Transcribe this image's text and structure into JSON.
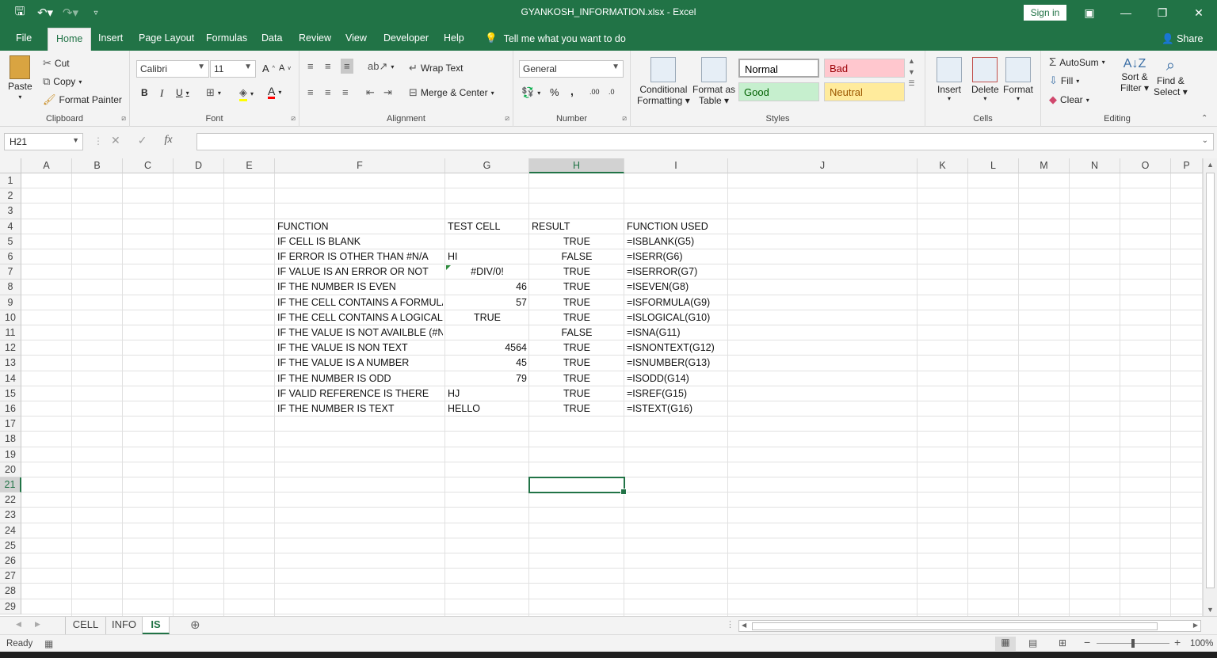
{
  "window": {
    "title": "GYANKOSH_INFORMATION.xlsx  -  Excel",
    "sign_in": "Sign in",
    "share": "Share"
  },
  "tabs": [
    "File",
    "Home",
    "Insert",
    "Page Layout",
    "Formulas",
    "Data",
    "Review",
    "View",
    "Developer",
    "Help"
  ],
  "active_tab": "Home",
  "tell_me": "Tell me what you want to do",
  "ribbon": {
    "clipboard": {
      "paste": "Paste",
      "cut": "Cut",
      "copy": "Copy",
      "format_painter": "Format Painter",
      "label": "Clipboard"
    },
    "font": {
      "name": "Calibri",
      "size": "11",
      "label": "Font",
      "bold": "B",
      "italic": "I",
      "underline": "U",
      "grow": "A",
      "shrink": "A",
      "font_color": "A"
    },
    "alignment": {
      "wrap_text": "Wrap Text",
      "merge_center": "Merge & Center",
      "label": "Alignment"
    },
    "number": {
      "format": "General",
      "percent": "%",
      "comma": ",",
      "inc_decimal": ".00",
      "dec_decimal": ".0",
      "label": "Number"
    },
    "styles": {
      "conditional_1": "Conditional",
      "conditional_2": "Formatting",
      "format_table_1": "Format as",
      "format_table_2": "Table",
      "normal": "Normal",
      "bad": "Bad",
      "good": "Good",
      "neutral": "Neutral",
      "label": "Styles"
    },
    "cells": {
      "insert": "Insert",
      "delete": "Delete",
      "format": "Format",
      "label": "Cells"
    },
    "editing": {
      "autosum": "AutoSum",
      "fill": "Fill",
      "clear": "Clear",
      "sort_1": "Sort &",
      "sort_2": "Filter",
      "find_1": "Find &",
      "find_2": "Select",
      "label": "Editing"
    }
  },
  "formula_bar": {
    "name_box": "H21",
    "cancel": "✕",
    "enter": "✓",
    "fx": "fx",
    "value": ""
  },
  "columns": [
    "A",
    "B",
    "C",
    "D",
    "E",
    "F",
    "G",
    "H",
    "I",
    "J",
    "K",
    "L",
    "M",
    "N",
    "O",
    "P"
  ],
  "rows": [
    "1",
    "2",
    "3",
    "4",
    "5",
    "6",
    "7",
    "8",
    "9",
    "10",
    "11",
    "12",
    "13",
    "14",
    "15",
    "16",
    "17",
    "18",
    "19",
    "20",
    "21",
    "22",
    "23",
    "24",
    "25",
    "26",
    "27",
    "28",
    "29"
  ],
  "selected_column": "H",
  "selected_row": "21",
  "table": {
    "headers": [
      "FUNCTION",
      "TEST CELL",
      "RESULT",
      "FUNCTION USED"
    ],
    "rows": [
      [
        "IF CELL IS BLANK",
        "",
        "TRUE",
        "=ISBLANK(G5)"
      ],
      [
        "IF ERROR IS OTHER THAN #N/A",
        "HI",
        "FALSE",
        "=ISERR(G6)"
      ],
      [
        "IF VALUE IS AN ERROR OR NOT",
        "#DIV/0!",
        "TRUE",
        "=ISERROR(G7)"
      ],
      [
        "IF THE NUMBER IS EVEN",
        "46",
        "TRUE",
        "=ISEVEN(G8)"
      ],
      [
        "IF THE CELL CONTAINS A FORMULA",
        "57",
        "TRUE",
        "=ISFORMULA(G9)"
      ],
      [
        "IF THE CELL CONTAINS A LOGICAL V",
        "TRUE",
        "TRUE",
        "=ISLOGICAL(G10)"
      ],
      [
        "IF THE VALUE IS NOT AVAILBLE (#N/A)",
        "",
        "FALSE",
        "=ISNA(G11)"
      ],
      [
        "IF THE VALUE IS NON TEXT",
        "4564",
        "TRUE",
        "=ISNONTEXT(G12)"
      ],
      [
        "IF THE VALUE IS A NUMBER",
        "45",
        "TRUE",
        "=ISNUMBER(G13)"
      ],
      [
        "IF THE NUMBER IS ODD",
        "79",
        "TRUE",
        "=ISODD(G14)"
      ],
      [
        "IF VALID REFERENCE IS THERE",
        "HJ",
        "TRUE",
        "=ISREF(G15)"
      ],
      [
        "IF THE NUMBER IS TEXT",
        "HELLO",
        "TRUE",
        "=ISTEXT(G16)"
      ]
    ],
    "test_align": [
      "left",
      "left",
      "center",
      "right",
      "right",
      "center",
      "left",
      "right",
      "right",
      "right",
      "left",
      "left"
    ]
  },
  "sheets": [
    "CELL",
    "INFO",
    "IS"
  ],
  "active_sheet": "IS",
  "status": {
    "ready": "Ready",
    "zoom": "100%"
  },
  "colors": {
    "accent": "#217346",
    "bad_bg": "#ffc7ce",
    "bad_fg": "#9c0006",
    "good_bg": "#c6efce",
    "good_fg": "#006100",
    "neutral_bg": "#ffeb9c",
    "neutral_fg": "#9c5700"
  }
}
